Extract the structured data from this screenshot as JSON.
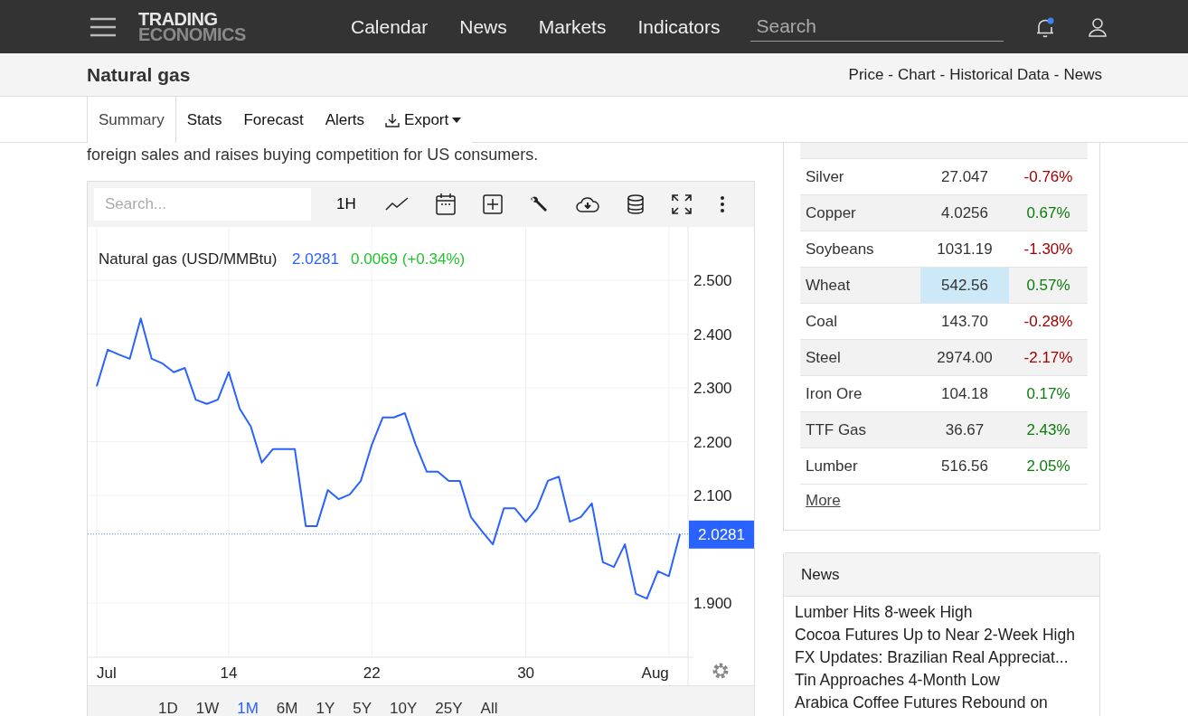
{
  "topbar": {
    "logo_top": "TRADING",
    "logo_bottom": "ECONOMICS",
    "nav": [
      "Calendar",
      "News",
      "Markets",
      "Indicators"
    ],
    "search": {
      "placeholder": "Search"
    },
    "has_notification": true
  },
  "subheader": {
    "title": "Natural gas",
    "links": [
      "Price",
      "Chart",
      "Historical Data",
      "News"
    ],
    "separator": "-"
  },
  "tabs": [
    {
      "label": "Summary",
      "kind": "tab",
      "selected": true
    },
    {
      "label": "Stats",
      "kind": "tab",
      "selected": false
    },
    {
      "label": "Forecast",
      "kind": "tab",
      "selected": false
    },
    {
      "label": "Alerts",
      "kind": "tab",
      "selected": false
    },
    {
      "label": "Export",
      "kind": "menu",
      "selected": false
    }
  ],
  "summary_tail": "foreign sales and raises buying competition for US consumers.",
  "chart": {
    "search": {
      "placeholder": "Search..."
    },
    "interval": "1H",
    "legend": {
      "name": "Natural gas (USD/MMBtu)",
      "price": "2.0281",
      "change": "0.0069 (+0.34%)"
    },
    "chart_data": {
      "type": "line",
      "categories": [
        "Jul",
        null,
        null,
        null,
        null,
        null,
        null,
        null,
        null,
        null,
        null,
        null,
        "14",
        null,
        null,
        null,
        null,
        null,
        null,
        null,
        null,
        null,
        null,
        null,
        null,
        "22",
        null,
        null,
        null,
        null,
        null,
        null,
        null,
        null,
        null,
        null,
        null,
        null,
        null,
        "30",
        null,
        null,
        null,
        null,
        null,
        null,
        null,
        null,
        null,
        null,
        null,
        null,
        "Aug",
        null
      ],
      "series": [
        {
          "color": "#2962ff",
          "values": [
            2.303,
            2.371,
            2.362,
            2.354,
            2.429,
            2.354,
            2.345,
            2.329,
            2.337,
            2.278,
            2.27,
            2.278,
            2.329,
            2.261,
            2.228,
            2.161,
            2.186,
            2.186,
            2.186,
            2.043,
            2.043,
            2.11,
            2.093,
            2.102,
            2.127,
            2.194,
            2.245,
            2.245,
            2.253,
            2.194,
            2.144,
            2.144,
            2.127,
            2.127,
            2.06,
            2.034,
            2.009,
            2.076,
            2.076,
            2.051,
            2.076,
            2.127,
            2.135,
            2.051,
            2.06,
            2.085,
            1.976,
            1.967,
            2.009,
            1.917,
            1.908,
            1.959,
            1.95,
            2.028
          ]
        }
      ],
      "ylim": [
        1.8,
        2.6
      ],
      "grid": true,
      "ref_lines": [
        {
          "axis": "y",
          "value": 2.0281,
          "label": "2.0281"
        }
      ],
      "yticks": [
        {
          "value": 2.5,
          "label": "2.500"
        },
        {
          "value": 2.4,
          "label": "2.400"
        },
        {
          "value": 2.3,
          "label": "2.300"
        },
        {
          "value": 2.2,
          "label": "2.200"
        },
        {
          "value": 2.1,
          "label": "2.100"
        },
        {
          "value": 1.9,
          "label": "1.900"
        }
      ]
    },
    "ranges": [
      {
        "label": "1D",
        "selected": false
      },
      {
        "label": "1W",
        "selected": false
      },
      {
        "label": "1M",
        "selected": true
      },
      {
        "label": "6M",
        "selected": false
      },
      {
        "label": "1Y",
        "selected": false
      },
      {
        "label": "5Y",
        "selected": false
      },
      {
        "label": "10Y",
        "selected": false
      },
      {
        "label": "25Y",
        "selected": false
      },
      {
        "label": "All",
        "selected": false
      }
    ]
  },
  "commodities": {
    "rows": [
      {
        "name": "Silver",
        "price": "27.047",
        "change": "-0.76%",
        "color": "#a50000",
        "highlighted": false
      },
      {
        "name": "Copper",
        "price": "4.0256",
        "change": "0.67%",
        "color": "#0a7d0a",
        "highlighted": false
      },
      {
        "name": "Soybeans",
        "price": "1031.19",
        "change": "-1.30%",
        "color": "#a50000",
        "highlighted": false
      },
      {
        "name": "Wheat",
        "price": "542.56",
        "change": "0.57%",
        "color": "#0a7d0a",
        "highlighted": true
      },
      {
        "name": "Coal",
        "price": "143.70",
        "change": "-0.28%",
        "color": "#a50000",
        "highlighted": false
      },
      {
        "name": "Steel",
        "price": "2974.00",
        "change": "-2.17%",
        "color": "#a50000",
        "highlighted": false
      },
      {
        "name": "Iron Ore",
        "price": "104.18",
        "change": "0.17%",
        "color": "#0a7d0a",
        "highlighted": false
      },
      {
        "name": "TTF Gas",
        "price": "36.67",
        "change": "2.43%",
        "color": "#0a7d0a",
        "highlighted": false
      },
      {
        "name": "Lumber",
        "price": "516.56",
        "change": "2.05%",
        "color": "#0a7d0a",
        "highlighted": false
      }
    ],
    "more": "More"
  },
  "news": {
    "title": "News",
    "items": [
      "Lumber Hits 8-week High",
      "Cocoa Futures Up to Near 2-Week High",
      "FX Updates: Brazilian Real Appreciat...",
      "Tin Approaches 4-Month Low",
      "Arabica Coffee Futures Rebound on"
    ]
  }
}
